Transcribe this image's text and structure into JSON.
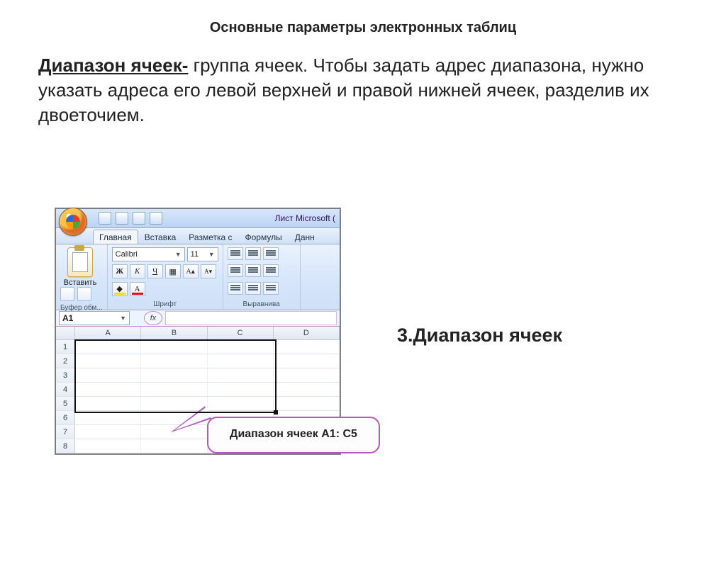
{
  "title": "Основные параметры электронных таблиц",
  "paragraph": {
    "term": "Диапазон ячеек-",
    "rest": " группа ячеек. Чтобы задать адрес диапазона, нужно указать адреса его левой верхней и правой нижней ячеек,  разделив их двоеточием."
  },
  "side_heading": "3.Диапазон ячеек",
  "callout": "Диапазон ячеек A1: C5",
  "excel": {
    "window_title": "Лист Microsoft (",
    "tabs": [
      "Главная",
      "Вставка",
      "Разметка с",
      "Формулы",
      "Данн"
    ],
    "active_tab": 0,
    "group_clipboard": {
      "button": "Вставить",
      "label": "Буфер обм..."
    },
    "group_font": {
      "font_name": "Calibri",
      "font_size": "11",
      "btn_bold": "Ж",
      "btn_italic": "К",
      "btn_underline": "Ч",
      "btn_a": "А",
      "label": "Шрифт"
    },
    "group_align": {
      "label": "Выравнива"
    },
    "namebox": "A1",
    "fx": "fx",
    "columns": [
      "A",
      "B",
      "C",
      "D"
    ],
    "rows": [
      "1",
      "2",
      "3",
      "4",
      "5",
      "6",
      "7",
      "8"
    ]
  },
  "chart_data": null
}
